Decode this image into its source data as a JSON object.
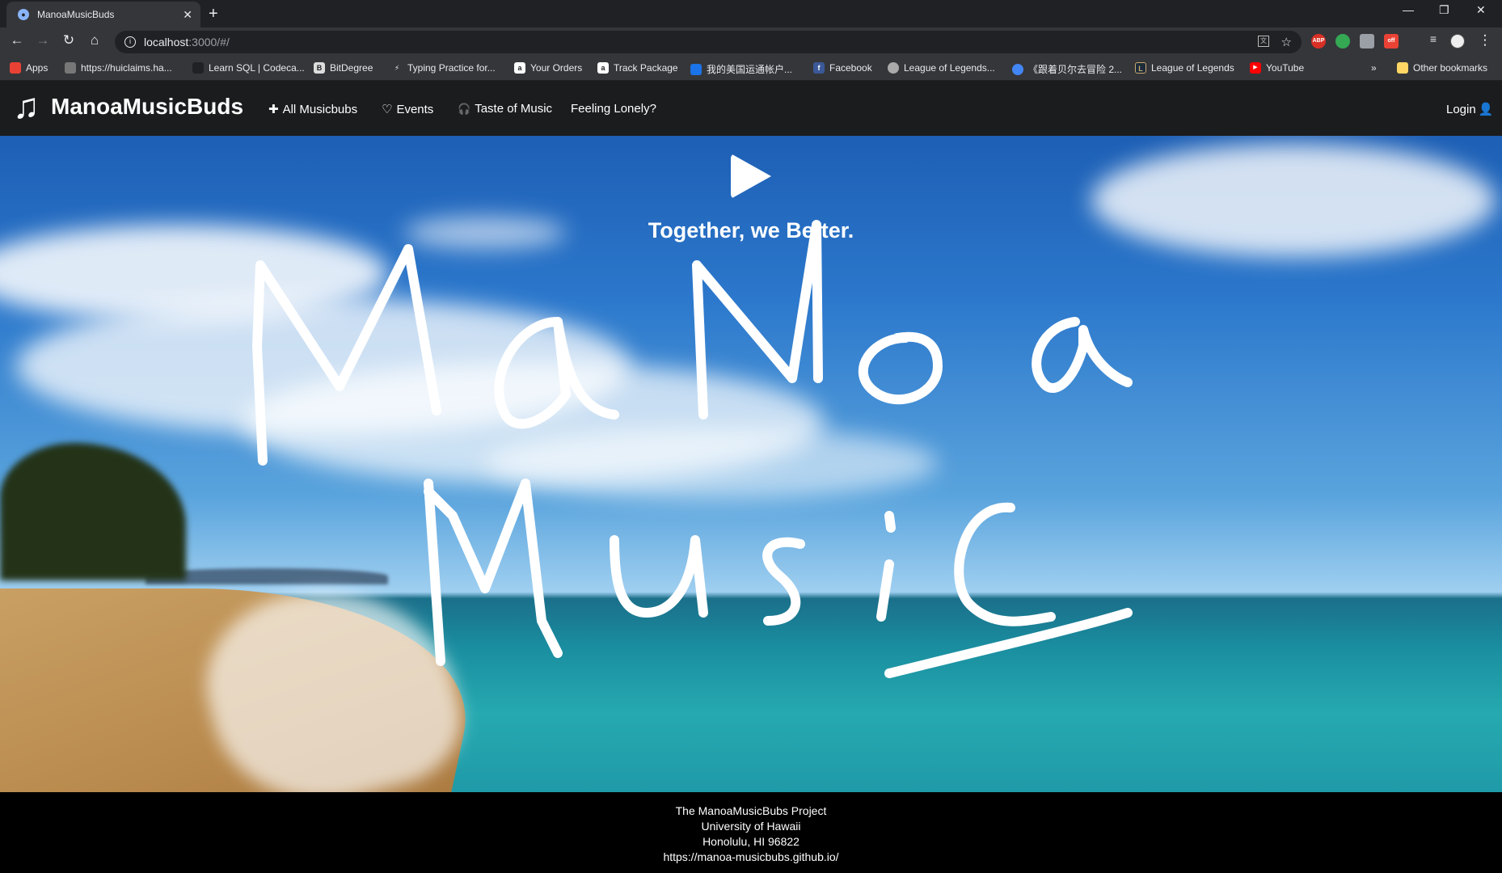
{
  "browser": {
    "tab_title": "ManoaMusicBuds",
    "new_tab_symbol": "+",
    "close_symbol": "✕",
    "url_host": "localhost",
    "url_path": ":3000/#/",
    "bookmarks": [
      {
        "label": "Apps",
        "color": "#e94235"
      },
      {
        "label": "https://huiclaims.ha...",
        "color": "#777777"
      },
      {
        "label": "Learn SQL | Codeca...",
        "color": "#202124"
      },
      {
        "label": "BitDegree",
        "color": "#dddddd"
      },
      {
        "label": "Typing Practice for...",
        "color": "#202124"
      },
      {
        "label": "Your Orders",
        "color": "#ffffff"
      },
      {
        "label": "Track Package",
        "color": "#ffffff"
      },
      {
        "label": "我的美国运通帐户...",
        "color": "#1a73e8"
      },
      {
        "label": "Facebook",
        "color": "#3b5998"
      },
      {
        "label": "League of Legends...",
        "color": "#aaaaaa"
      },
      {
        "label": "《跟着贝尔去冒险 2...",
        "color": "#4285f4"
      },
      {
        "label": "League of Legends",
        "color": "#c8aa6e"
      },
      {
        "label": "YouTube",
        "color": "#ff0000"
      }
    ],
    "more_bookmarks": "»",
    "other_bookmarks": "Other bookmarks",
    "extensions": {
      "abp": "ABP",
      "off": "off"
    }
  },
  "navbar": {
    "brand": "ManoaMusicBuds",
    "items": [
      {
        "icon": "plus-icon",
        "glyph": "✚",
        "label": "All Musicbubs"
      },
      {
        "icon": "heart-icon",
        "glyph": "♡",
        "label": "Events"
      },
      {
        "icon": "headphones-icon",
        "glyph": "🎧",
        "label": "Taste of Music"
      },
      {
        "label": "Feeling Lonely?"
      }
    ],
    "login": "Login"
  },
  "hero": {
    "tagline": "Together, we Better.",
    "scrawl_line1": "MaNoa",
    "scrawl_line2": "Music"
  },
  "footer": {
    "line1": "The ManoaMusicBubs Project",
    "line2": "University of Hawaii",
    "line3": "Honolulu, HI 96822",
    "line4": "https://manoa-musicbubs.github.io/"
  }
}
